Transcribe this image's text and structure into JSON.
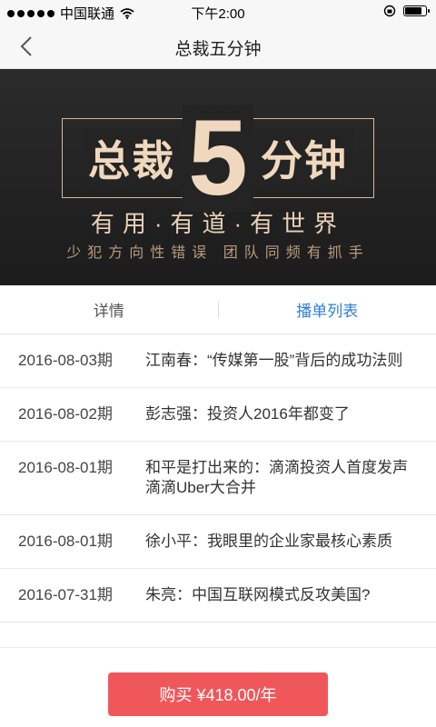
{
  "status_bar": {
    "carrier": "中国联通",
    "time": "下午2:00",
    "battery_level": 0.85
  },
  "nav": {
    "title": "总裁五分钟",
    "back_icon": "chevron-left-icon"
  },
  "banner": {
    "brand_left": "总裁",
    "brand_number": "5",
    "brand_right": "分钟",
    "slogan": "有用·有道·有世界",
    "subtitle": "少犯方向性错误  团队同频有抓手"
  },
  "tabs": [
    {
      "label": "详情",
      "active": false
    },
    {
      "label": "播单列表",
      "active": true
    }
  ],
  "episodes": [
    {
      "date": "2016-08-03期",
      "title": "江南春：“传媒第一股”背后的成功法则"
    },
    {
      "date": "2016-08-02期",
      "title": "彭志强：投资人2016年都变了"
    },
    {
      "date": "2016-08-01期",
      "title": "和平是打出来的：滴滴投资人首度发声滴滴Uber大合并"
    },
    {
      "date": "2016-08-01期",
      "title": "徐小平：我眼里的企业家最核心素质"
    },
    {
      "date": "2016-07-31期",
      "title": "朱亮：中国互联网模式反攻美国?"
    }
  ],
  "purchase": {
    "label": "购买 ¥418.00/年"
  },
  "colors": {
    "accent_blue": "#2f7fd8",
    "buy_red": "#f0575b",
    "banner_gold": "#f0d8be"
  }
}
